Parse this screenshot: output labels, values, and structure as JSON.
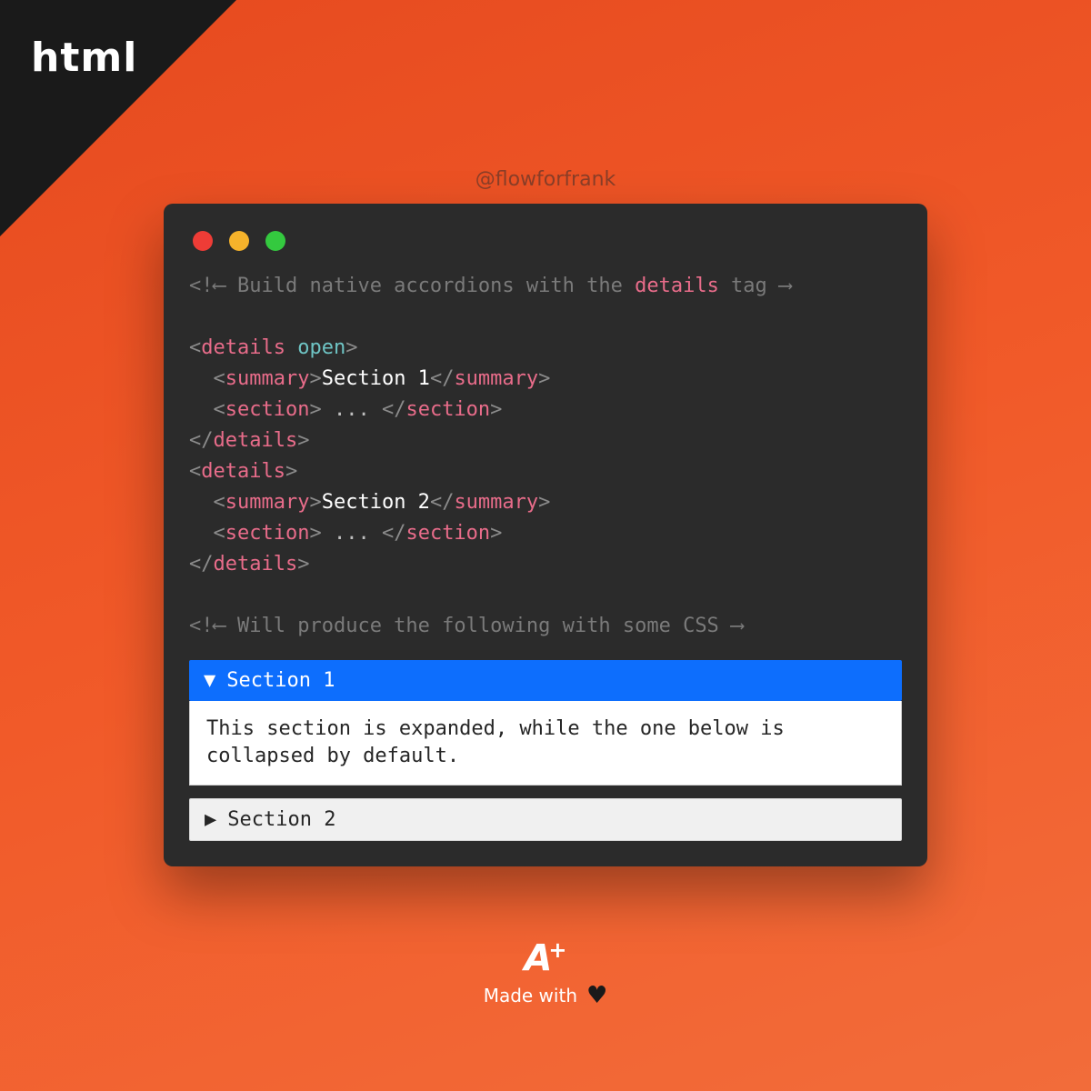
{
  "brand": "html",
  "handle": "@flowforfrank",
  "code": {
    "comment1_prefix": "Build native accordions with the ",
    "comment1_tag": "details",
    "comment1_suffix": " tag",
    "tag_details": "details",
    "attr_open": "open",
    "tag_summary": "summary",
    "tag_section": "section",
    "section1_label": "Section 1",
    "section2_label": "Section 2",
    "ellipsis": " ... ",
    "comment2": "Will produce the following with some CSS"
  },
  "preview": {
    "section1_title": "Section 1",
    "section1_body": "This section is expanded, while the one below is collapsed by default.",
    "section2_title": "Section 2"
  },
  "footer": {
    "logo_main": "A",
    "logo_plus": "+",
    "made_with": "Made with",
    "heart": "♥"
  },
  "glyphs": {
    "tri_down": "▼",
    "tri_right": "▶",
    "arrow_left": "⟵",
    "arrow_right": "⟶",
    "bang": "!",
    "lt": "<",
    "gt": ">",
    "slash": "/"
  },
  "colors": {
    "accent_blue": "#0d6efd",
    "bg_orange": "#f15a29",
    "window_bg": "#2b2b2b"
  }
}
